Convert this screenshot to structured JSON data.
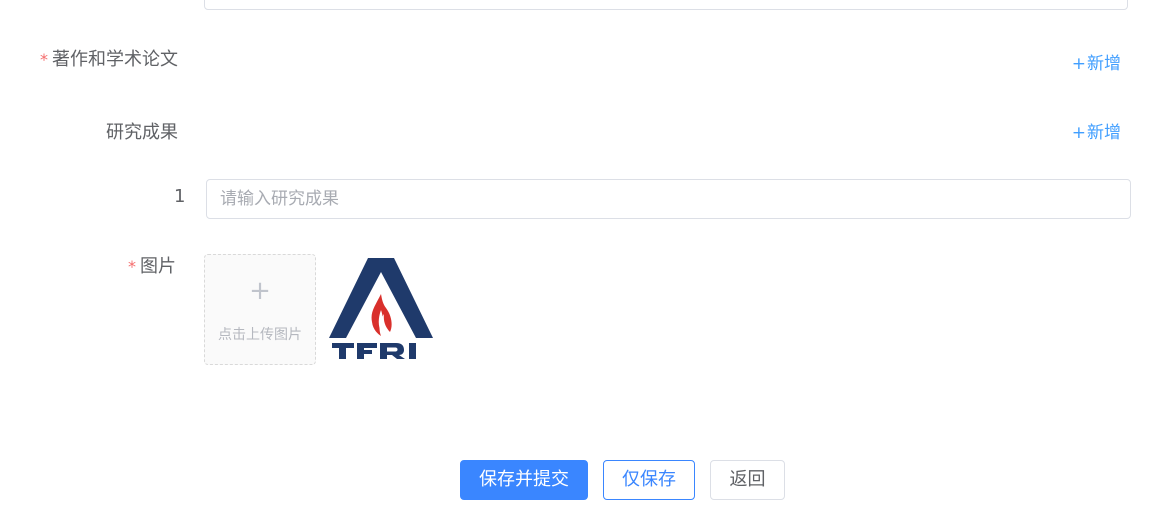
{
  "form": {
    "works": {
      "required_mark": "*",
      "label": "著作和学术论文",
      "add_plus": "+",
      "add_label": "新增"
    },
    "results": {
      "label": "研究成果",
      "add_plus": "+",
      "add_label": "新增",
      "items": [
        {
          "index": "1",
          "placeholder": "请输入研究成果",
          "value": ""
        }
      ]
    },
    "image": {
      "required_mark": "*",
      "label": "图片",
      "upload_plus": "+",
      "upload_text": "点击上传图片",
      "logo_text": "TFRI"
    }
  },
  "actions": {
    "save_submit": "保存并提交",
    "save_only": "仅保存",
    "back": "返回"
  },
  "colors": {
    "primary": "#3a86ff",
    "link": "#409eff",
    "required": "#f56c6c",
    "logo_navy": "#1f3a6b",
    "logo_red": "#d9302c"
  }
}
